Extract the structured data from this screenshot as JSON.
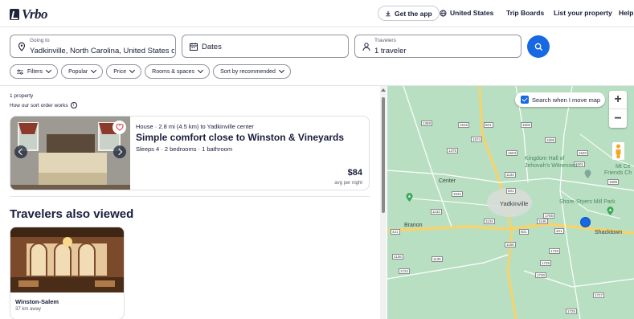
{
  "header": {
    "logo_text": "Vrbo",
    "get_app": "Get the app",
    "region": "United States",
    "trip_boards": "Trip Boards",
    "list_property": "List your property",
    "help": "Help"
  },
  "search": {
    "going_to_label": "Going to",
    "going_to_value": "Yadkinville, North Carolina, United States of ...",
    "dates_value": "Dates",
    "travelers_label": "Travelers",
    "travelers_value": "1 traveler"
  },
  "filters": {
    "filters": "Filters",
    "popular": "Popular",
    "price": "Price",
    "rooms": "Rooms & spaces",
    "sort": "Sort by recommended"
  },
  "results": {
    "count": "1 property",
    "sort_info": "How our sort order works",
    "listing": {
      "subtitle": "House · 2.8 mi (4.5 km) to Yadkinville center",
      "title": "Simple comfort close to Winston & Vineyards",
      "meta": "Sleeps 4 · 2 bedrooms · 1 bathroom",
      "price": "$84",
      "price_label": "avg per night"
    },
    "also_viewed_title": "Travelers also viewed",
    "also_viewed": {
      "name": "Winston-Salem",
      "distance": "37 km away"
    }
  },
  "map": {
    "search_move_label": "Search when I move map",
    "zoom_in": "+",
    "zoom_out": "−",
    "labels": {
      "yadkinville": "Yadkinville",
      "center": "Center",
      "branon": "Branon",
      "shacktown": "Shacktown",
      "kingdom_hall": "Kingdom Hall of",
      "jehovah": "Jehovah's Witnesses",
      "shore_styers": "Shore-Styers Mill Park",
      "mt_ce": "Mt Ce",
      "friends_ch": "Friends Ch"
    },
    "roads": [
      "1368",
      "1516",
      "601",
      "1506",
      "1375",
      "1574",
      "1503",
      "1505",
      "1134",
      "1531",
      "601",
      "1765",
      "1146",
      "1134",
      "601",
      "421",
      "1136",
      "1726",
      "1136",
      "1156",
      "1729",
      "1725",
      "1730",
      "1717",
      "1722",
      "1520",
      "1501",
      "1133",
      "1599",
      "421"
    ]
  },
  "colors": {
    "brand_blue": "#1668e3",
    "text": "#191e3b",
    "map_green": "#b9dfc3"
  }
}
